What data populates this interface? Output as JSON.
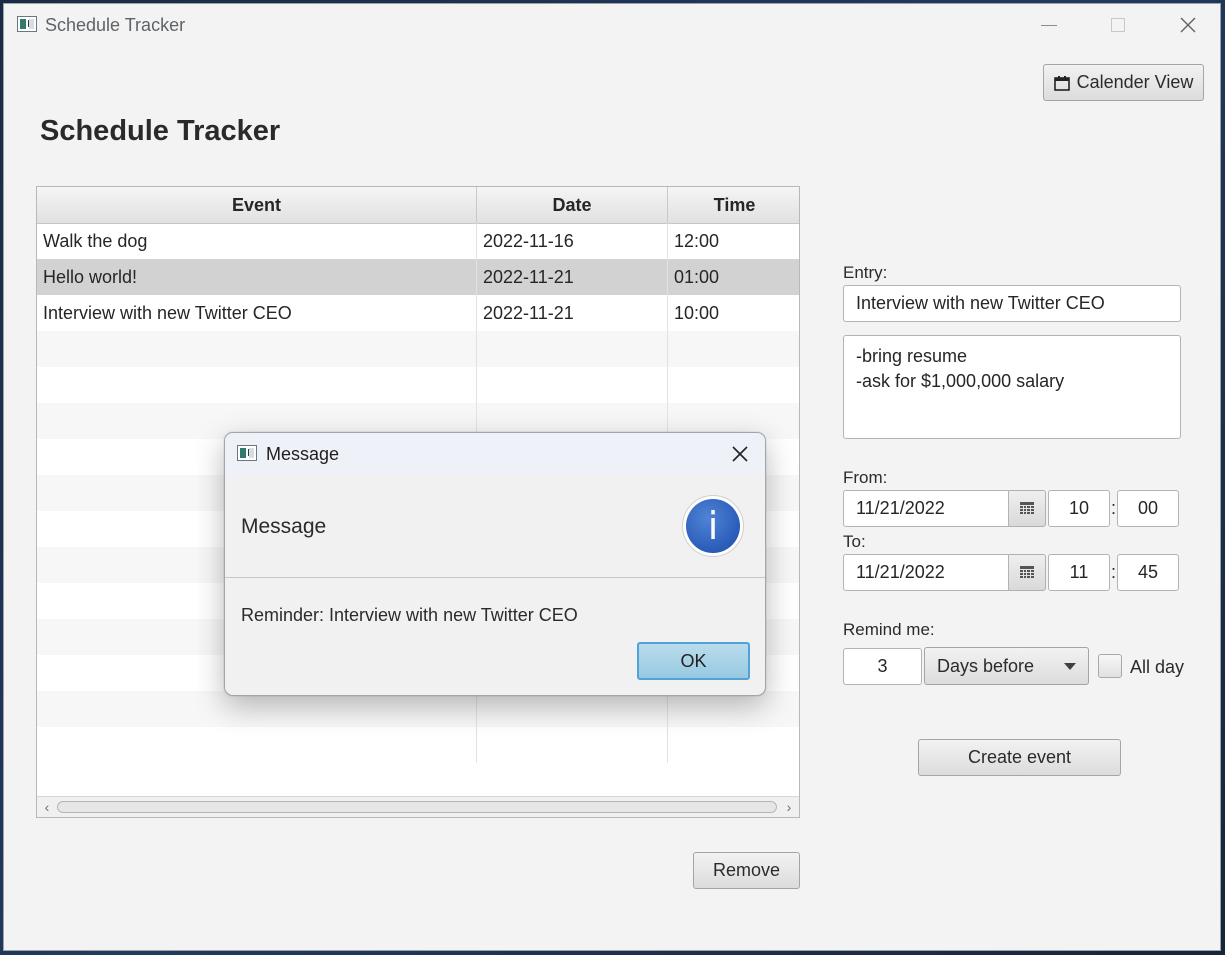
{
  "window": {
    "title": "Schedule Tracker"
  },
  "toolbar": {
    "calendar_view_label": "Calender View"
  },
  "app_title": "Schedule Tracker",
  "table": {
    "columns": [
      "Event",
      "Date",
      "Time"
    ],
    "rows": [
      {
        "event": "Walk the dog",
        "date": "2022-11-16",
        "time": "12:00"
      },
      {
        "event": "Hello world!",
        "date": "2022-11-21",
        "time": "01:00"
      },
      {
        "event": "Interview with new Twitter CEO",
        "date": "2022-11-21",
        "time": "10:00"
      }
    ],
    "selected_row": 2
  },
  "remove_label": "Remove",
  "form": {
    "entry_label": "Entry:",
    "entry_value": "Interview with new Twitter CEO",
    "notes": [
      "-bring resume",
      "-ask for $1,000,000 salary"
    ],
    "from_label": "From:",
    "from": {
      "date": "11/21/2022",
      "hour": "10",
      "minute": "00"
    },
    "to_label": "To:",
    "to": {
      "date": "11/21/2022",
      "hour": "11",
      "minute": "45"
    },
    "colon": ":",
    "remind_label": "Remind me:",
    "remind_value": "3",
    "remind_unit": "Days before",
    "all_day_label": "All day",
    "all_day_checked": false,
    "create_label": "Create event"
  },
  "dialog": {
    "title": "Message",
    "header": "Message",
    "icon": "info-icon",
    "body": "Reminder: Interview with new Twitter CEO",
    "ok_label": "OK"
  }
}
